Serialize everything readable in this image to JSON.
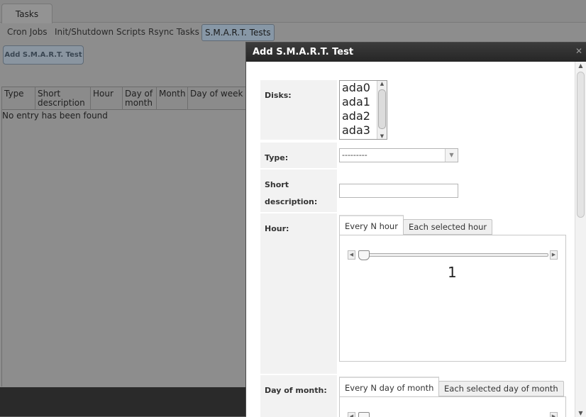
{
  "top_tab": {
    "label": "Tasks"
  },
  "sub_tabs": [
    {
      "label": "Cron Jobs"
    },
    {
      "label": "Init/Shutdown Scripts"
    },
    {
      "label": "Rsync Tasks"
    },
    {
      "label": "S.M.A.R.T. Tests"
    }
  ],
  "add_button": {
    "label": "Add S.M.A.R.T. Test"
  },
  "grid": {
    "columns": [
      {
        "label": "Type"
      },
      {
        "label": "Short description"
      },
      {
        "label": "Hour"
      },
      {
        "label": "Day of month"
      },
      {
        "label": "Month"
      },
      {
        "label": "Day of week"
      }
    ],
    "empty_message": "No entry has been found"
  },
  "dialog": {
    "title": "Add S.M.A.R.T. Test",
    "close_icon": "close-icon",
    "fields": {
      "disks": {
        "label": "Disks:",
        "options": [
          "ada0",
          "ada1",
          "ada2",
          "ada3"
        ]
      },
      "type": {
        "label": "Type:",
        "value": "---------"
      },
      "short_description": {
        "label": "Short description:",
        "value": ""
      },
      "hour": {
        "label": "Hour:",
        "tabs": [
          "Every N hour",
          "Each selected hour"
        ],
        "active_tab": "Every N hour",
        "slider_value": "1"
      },
      "day_of_month": {
        "label": "Day of month:",
        "tabs": [
          "Every N day of month",
          "Each selected day of month"
        ],
        "active_tab": "Every N day of month"
      }
    }
  }
}
